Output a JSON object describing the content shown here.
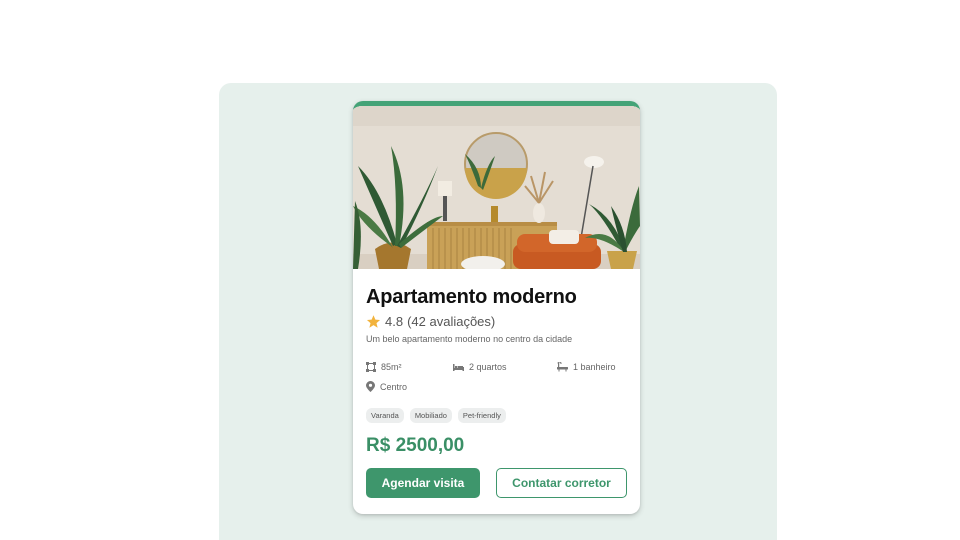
{
  "listing": {
    "title": "Apartamento moderno",
    "rating_value": "4.8",
    "rating_count": "(42 avaliações)",
    "description": "Um belo apartamento moderno no centro da cidade",
    "features": {
      "area": "85m²",
      "bedrooms": "2 quartos",
      "bathrooms": "1 banheiro",
      "location": "Centro"
    },
    "tags": [
      "Varanda",
      "Mobiliado",
      "Pet-friendly"
    ],
    "price": "R$ 2500,00",
    "primary_action": "Agendar visita",
    "secondary_action": "Contatar corretor"
  },
  "icons": {
    "rating": "star-icon",
    "area": "area-icon",
    "bedrooms": "bed-icon",
    "bathrooms": "bathtub-icon",
    "location": "map-pin-icon"
  },
  "colors": {
    "accent": "#3e966c",
    "accent_top_border": "#44a377",
    "price": "#3a8f66",
    "star": "#f2b33d",
    "background_panel": "#e6f0ec"
  }
}
